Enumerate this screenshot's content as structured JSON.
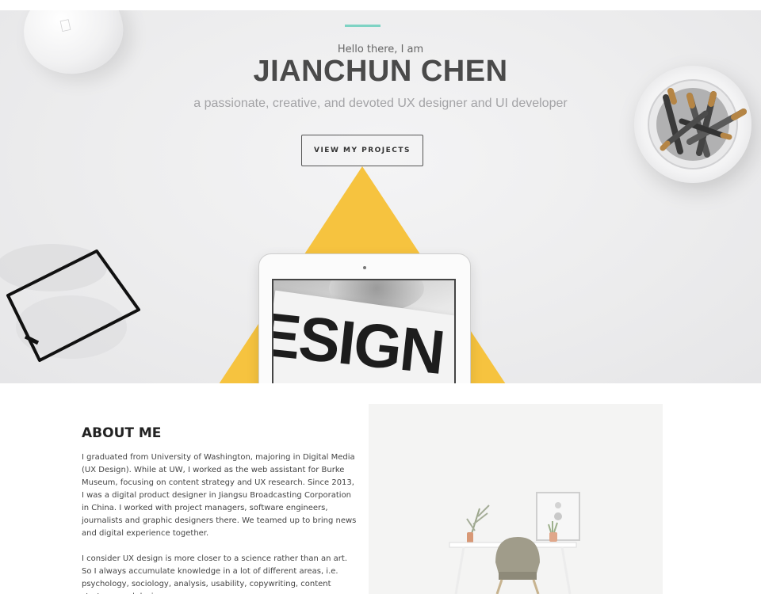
{
  "hero": {
    "greeting": "Hello there, I am",
    "name": "JIANCHUN CHEN",
    "tagline": "a passionate, creative, and devoted UX designer and UI developer",
    "cta_label": "VIEW MY PROJECTS",
    "tablet_word": "ESIGN"
  },
  "about": {
    "title": "ABOUT ME",
    "paragraphs": [
      "I graduated from University of Washington, majoring in Digital Media (UX Design). While at UW, I worked as the web assistant for Burke Museum, focusing on content strategy and UX research. Since 2013, I was a digital product designer in Jiangsu Broadcasting Corporation in China. I worked with project managers, software engineers, journalists and graphic designers there. We teamed up to bring news and digital experience together.",
      "I consider UX design is more closer to a science rather than an art. So I always accumulate knowledge in a lot of different areas, i.e. psychology, sociology, analysis, usability, copywriting, content strategy, and design."
    ]
  },
  "colors": {
    "accent_line": "#7ed3c4",
    "triangle": "#f6c33f"
  },
  "icons": {
    "mouse_logo": "apple-logo-icon"
  }
}
